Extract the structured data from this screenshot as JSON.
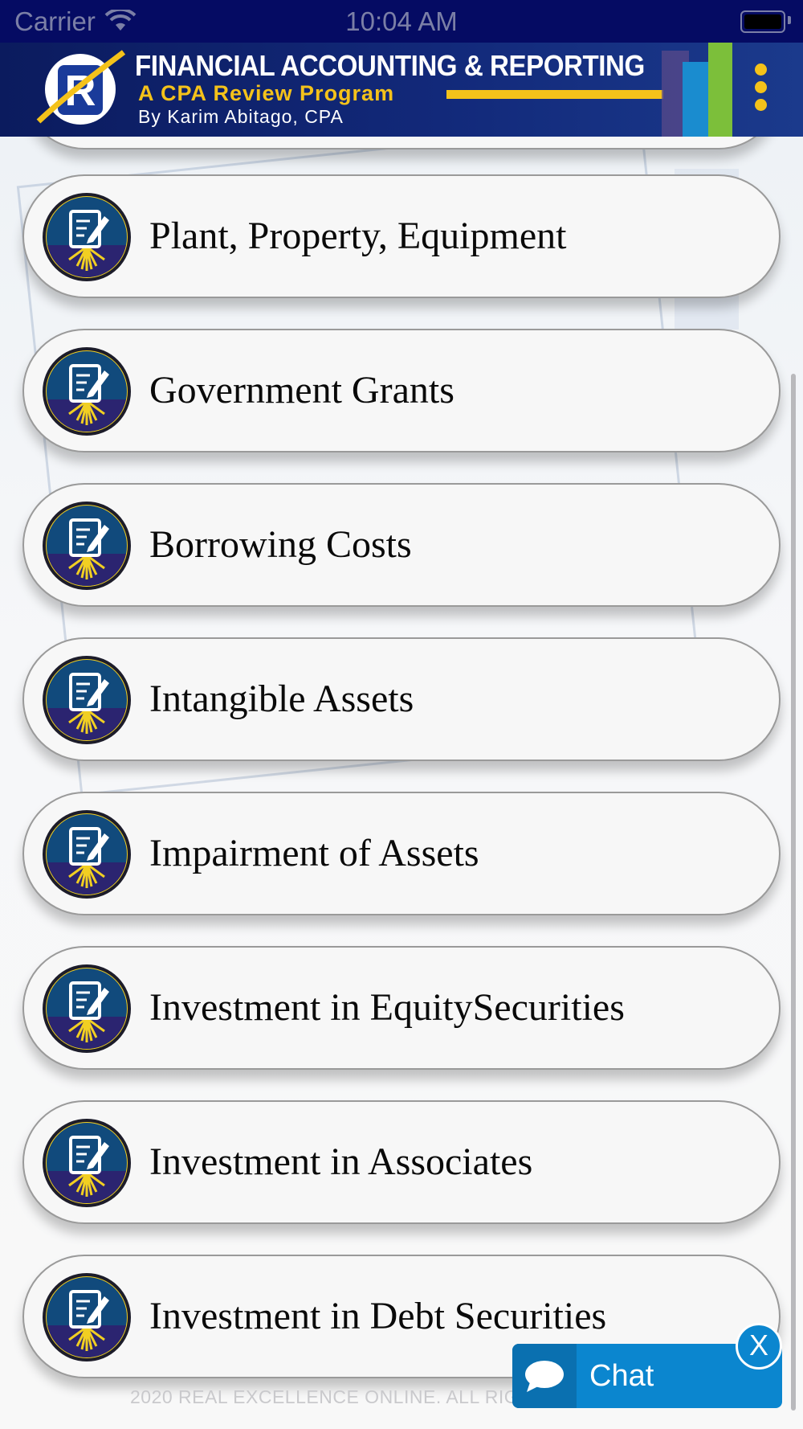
{
  "status_bar": {
    "carrier": "Carrier",
    "time": "10:04 AM"
  },
  "header": {
    "title": "FINANCIAL ACCOUNTING & REPORTING",
    "subtitle": "A CPA Review Program",
    "byline": "By Karim Abitago, CPA",
    "logo_letter": "R"
  },
  "topics": [
    {
      "label": ""
    },
    {
      "label": "Plant, Property, Equipment"
    },
    {
      "label": "Government Grants"
    },
    {
      "label": "Borrowing Costs"
    },
    {
      "label": "Intangible Assets"
    },
    {
      "label": "Impairment of Assets"
    },
    {
      "label": "Investment in EquitySecurities"
    },
    {
      "label": "Investment in Associates"
    },
    {
      "label": "Investment in Debt Securities"
    }
  ],
  "footer": {
    "text": "2020 REAL EXCELLENCE ONLINE. ALL RIG"
  },
  "chat": {
    "label": "Chat",
    "close_label": "X"
  },
  "colors": {
    "status_bar_bg": "#050b63",
    "header_bg": "#12297a",
    "accent_yellow": "#f4c21a",
    "chat_blue": "#0b86cf",
    "icon_navy": "#1b2a6b"
  }
}
